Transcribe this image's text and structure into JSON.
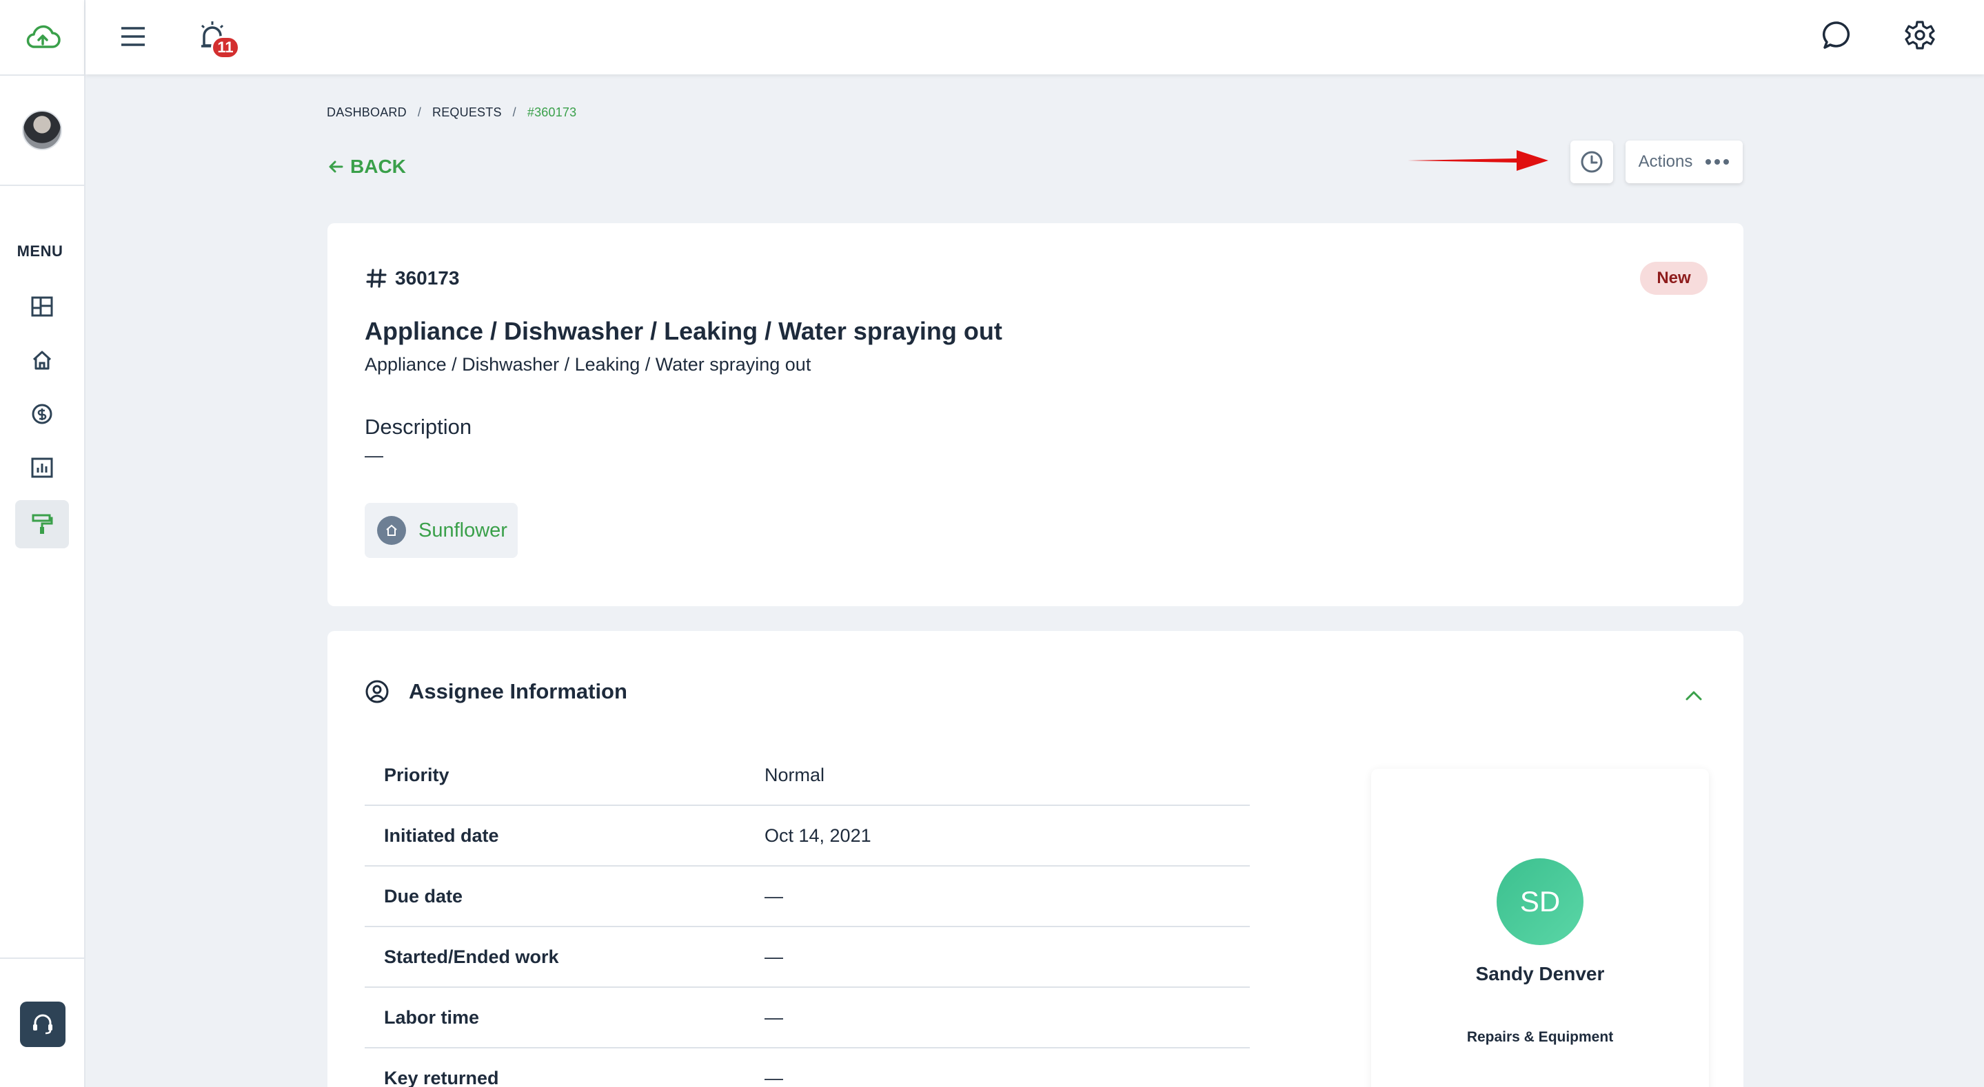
{
  "colors": {
    "accent": "#3aa04a",
    "background": "#eef1f5",
    "badge_red": "#d32f2f",
    "status_new_bg": "#f7dcdc",
    "avatar_green": "#3cc08f",
    "annotation_arrow": "#e01010"
  },
  "sidebar": {
    "logo_icon": "cloud-upload-icon",
    "menu_label": "MENU",
    "items": [
      {
        "icon": "dashboard-grid-icon"
      },
      {
        "icon": "home-icon"
      },
      {
        "icon": "dollar-circle-icon"
      },
      {
        "icon": "bar-chart-icon"
      },
      {
        "icon": "paint-roller-icon",
        "active": true
      }
    ],
    "support_icon": "headset-icon"
  },
  "topbar": {
    "menu_icon": "hamburger-icon",
    "alarm_icon": "alarm-icon",
    "notification_count": "11",
    "chat_icon": "chat-icon",
    "settings_icon": "gear-icon"
  },
  "breadcrumb": {
    "items": [
      "DASHBOARD",
      "REQUESTS"
    ],
    "separator": "/",
    "current": "#360173"
  },
  "back_label": "BACK",
  "toolbar": {
    "history_icon": "clock-icon",
    "actions_label": "Actions"
  },
  "request": {
    "id": "360173",
    "status": "New",
    "title": "Appliance / Dishwasher / Leaking / Water spraying out",
    "subtitle": "Appliance / Dishwasher / Leaking / Water spraying out",
    "description_label": "Description",
    "description_value": "—",
    "property": "Sunflower"
  },
  "assignee": {
    "heading": "Assignee Information",
    "rows": [
      {
        "label": "Priority",
        "value": "Normal"
      },
      {
        "label": "Initiated date",
        "value": "Oct 14, 2021"
      },
      {
        "label": "Due date",
        "value": "—"
      },
      {
        "label": "Started/Ended work",
        "value": "—"
      },
      {
        "label": "Labor time",
        "value": "—"
      },
      {
        "label": "Key returned",
        "value": "—"
      }
    ],
    "person": {
      "initials": "SD",
      "name": "Sandy Denver",
      "role": "Repairs & Equipment"
    }
  }
}
